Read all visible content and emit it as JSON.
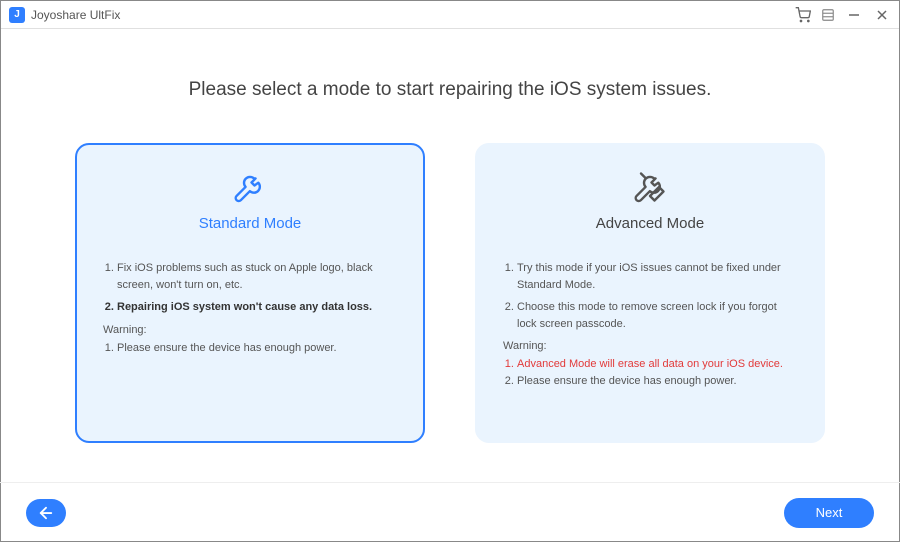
{
  "app": {
    "title": "Joyoshare UltFix",
    "icon_letter": "J"
  },
  "header": {
    "main_title": "Please select a mode to start repairing the iOS system issues."
  },
  "modes": {
    "standard": {
      "title": "Standard Mode",
      "item1": "Fix iOS problems such as stuck on Apple logo, black screen, won't turn on, etc.",
      "item2": "Repairing iOS system won't cause any data loss.",
      "warning_label": "Warning:",
      "warning1": "Please ensure the device has enough power."
    },
    "advanced": {
      "title": "Advanced Mode",
      "item1": "Try this mode if your iOS issues cannot be fixed under Standard Mode.",
      "item2": "Choose this mode to remove screen lock if you forgot lock screen passcode.",
      "warning_label": "Warning:",
      "warning1": "Advanced Mode will erase all data on your iOS device.",
      "warning2": "Please ensure the device has enough power."
    }
  },
  "footer": {
    "next_label": "Next"
  }
}
